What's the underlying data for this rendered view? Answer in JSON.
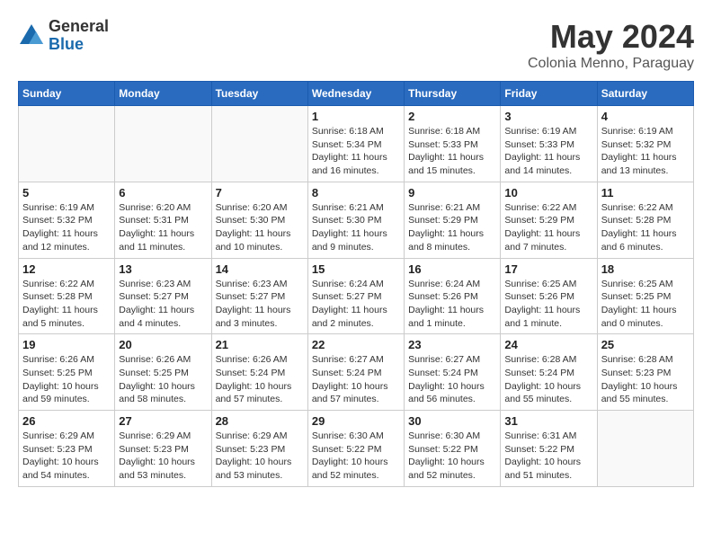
{
  "logo": {
    "general": "General",
    "blue": "Blue"
  },
  "header": {
    "title": "May 2024",
    "subtitle": "Colonia Menno, Paraguay"
  },
  "weekdays": [
    "Sunday",
    "Monday",
    "Tuesday",
    "Wednesday",
    "Thursday",
    "Friday",
    "Saturday"
  ],
  "weeks": [
    [
      {
        "day": "",
        "info": ""
      },
      {
        "day": "",
        "info": ""
      },
      {
        "day": "",
        "info": ""
      },
      {
        "day": "1",
        "info": "Sunrise: 6:18 AM\nSunset: 5:34 PM\nDaylight: 11 hours\nand 16 minutes."
      },
      {
        "day": "2",
        "info": "Sunrise: 6:18 AM\nSunset: 5:33 PM\nDaylight: 11 hours\nand 15 minutes."
      },
      {
        "day": "3",
        "info": "Sunrise: 6:19 AM\nSunset: 5:33 PM\nDaylight: 11 hours\nand 14 minutes."
      },
      {
        "day": "4",
        "info": "Sunrise: 6:19 AM\nSunset: 5:32 PM\nDaylight: 11 hours\nand 13 minutes."
      }
    ],
    [
      {
        "day": "5",
        "info": "Sunrise: 6:19 AM\nSunset: 5:32 PM\nDaylight: 11 hours\nand 12 minutes."
      },
      {
        "day": "6",
        "info": "Sunrise: 6:20 AM\nSunset: 5:31 PM\nDaylight: 11 hours\nand 11 minutes."
      },
      {
        "day": "7",
        "info": "Sunrise: 6:20 AM\nSunset: 5:30 PM\nDaylight: 11 hours\nand 10 minutes."
      },
      {
        "day": "8",
        "info": "Sunrise: 6:21 AM\nSunset: 5:30 PM\nDaylight: 11 hours\nand 9 minutes."
      },
      {
        "day": "9",
        "info": "Sunrise: 6:21 AM\nSunset: 5:29 PM\nDaylight: 11 hours\nand 8 minutes."
      },
      {
        "day": "10",
        "info": "Sunrise: 6:22 AM\nSunset: 5:29 PM\nDaylight: 11 hours\nand 7 minutes."
      },
      {
        "day": "11",
        "info": "Sunrise: 6:22 AM\nSunset: 5:28 PM\nDaylight: 11 hours\nand 6 minutes."
      }
    ],
    [
      {
        "day": "12",
        "info": "Sunrise: 6:22 AM\nSunset: 5:28 PM\nDaylight: 11 hours\nand 5 minutes."
      },
      {
        "day": "13",
        "info": "Sunrise: 6:23 AM\nSunset: 5:27 PM\nDaylight: 11 hours\nand 4 minutes."
      },
      {
        "day": "14",
        "info": "Sunrise: 6:23 AM\nSunset: 5:27 PM\nDaylight: 11 hours\nand 3 minutes."
      },
      {
        "day": "15",
        "info": "Sunrise: 6:24 AM\nSunset: 5:27 PM\nDaylight: 11 hours\nand 2 minutes."
      },
      {
        "day": "16",
        "info": "Sunrise: 6:24 AM\nSunset: 5:26 PM\nDaylight: 11 hours\nand 1 minute."
      },
      {
        "day": "17",
        "info": "Sunrise: 6:25 AM\nSunset: 5:26 PM\nDaylight: 11 hours\nand 1 minute."
      },
      {
        "day": "18",
        "info": "Sunrise: 6:25 AM\nSunset: 5:25 PM\nDaylight: 11 hours\nand 0 minutes."
      }
    ],
    [
      {
        "day": "19",
        "info": "Sunrise: 6:26 AM\nSunset: 5:25 PM\nDaylight: 10 hours\nand 59 minutes."
      },
      {
        "day": "20",
        "info": "Sunrise: 6:26 AM\nSunset: 5:25 PM\nDaylight: 10 hours\nand 58 minutes."
      },
      {
        "day": "21",
        "info": "Sunrise: 6:26 AM\nSunset: 5:24 PM\nDaylight: 10 hours\nand 57 minutes."
      },
      {
        "day": "22",
        "info": "Sunrise: 6:27 AM\nSunset: 5:24 PM\nDaylight: 10 hours\nand 57 minutes."
      },
      {
        "day": "23",
        "info": "Sunrise: 6:27 AM\nSunset: 5:24 PM\nDaylight: 10 hours\nand 56 minutes."
      },
      {
        "day": "24",
        "info": "Sunrise: 6:28 AM\nSunset: 5:24 PM\nDaylight: 10 hours\nand 55 minutes."
      },
      {
        "day": "25",
        "info": "Sunrise: 6:28 AM\nSunset: 5:23 PM\nDaylight: 10 hours\nand 55 minutes."
      }
    ],
    [
      {
        "day": "26",
        "info": "Sunrise: 6:29 AM\nSunset: 5:23 PM\nDaylight: 10 hours\nand 54 minutes."
      },
      {
        "day": "27",
        "info": "Sunrise: 6:29 AM\nSunset: 5:23 PM\nDaylight: 10 hours\nand 53 minutes."
      },
      {
        "day": "28",
        "info": "Sunrise: 6:29 AM\nSunset: 5:23 PM\nDaylight: 10 hours\nand 53 minutes."
      },
      {
        "day": "29",
        "info": "Sunrise: 6:30 AM\nSunset: 5:22 PM\nDaylight: 10 hours\nand 52 minutes."
      },
      {
        "day": "30",
        "info": "Sunrise: 6:30 AM\nSunset: 5:22 PM\nDaylight: 10 hours\nand 52 minutes."
      },
      {
        "day": "31",
        "info": "Sunrise: 6:31 AM\nSunset: 5:22 PM\nDaylight: 10 hours\nand 51 minutes."
      },
      {
        "day": "",
        "info": ""
      }
    ]
  ]
}
